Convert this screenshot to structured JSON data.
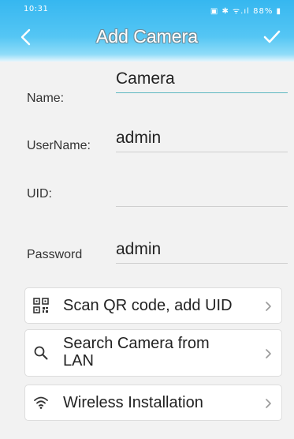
{
  "status_bar": {
    "time": "10:31",
    "indicators": "▣ ✱ ᯤ.ıl 88% ▮"
  },
  "header": {
    "title": "Add Camera",
    "back_icon": "chevron-left-icon",
    "confirm_icon": "checkmark-icon"
  },
  "form": {
    "name_label": "Name:",
    "name_value": "Camera",
    "username_label": "UserName:",
    "username_value": "admin",
    "uid_label": "UID:",
    "uid_value": "",
    "password_label": "Password",
    "password_value": "admin"
  },
  "actions": [
    {
      "label": "Scan QR code, add UID",
      "icon": "qr-code-icon"
    },
    {
      "label": "Search Camera from LAN",
      "icon": "search-icon"
    },
    {
      "label": "Wireless Installation",
      "icon": "wifi-icon"
    }
  ],
  "colors": {
    "header_top": "#36b7f0",
    "header_bottom": "#8fdcf8",
    "background": "#f2f2f2",
    "active_underline": "#5fb8c2"
  }
}
